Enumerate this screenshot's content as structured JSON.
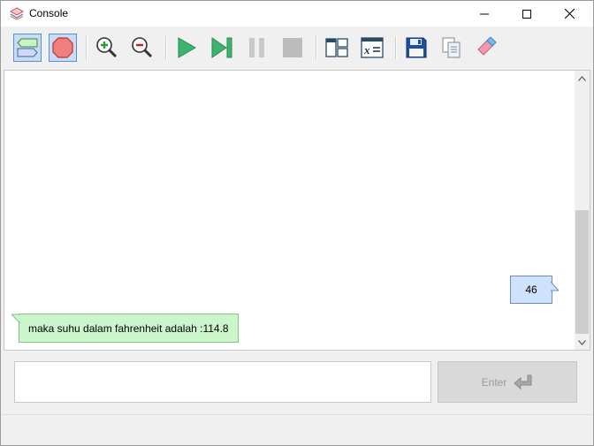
{
  "window": {
    "title": "Console"
  },
  "titlebar": {
    "minimize_icon": "minimize-icon",
    "maximize_icon": "maximize-icon",
    "close_icon": "close-icon"
  },
  "toolbar": {
    "buttons": [
      {
        "name": "console-mode-icon",
        "toggled": true
      },
      {
        "name": "stop-sign-icon",
        "toggled": true
      },
      {
        "name": "zoom-in-icon",
        "toggled": false
      },
      {
        "name": "zoom-out-icon",
        "toggled": false
      },
      {
        "name": "run-icon",
        "toggled": false
      },
      {
        "name": "step-icon",
        "toggled": false
      },
      {
        "name": "pause-icon",
        "toggled": false
      },
      {
        "name": "stop-icon",
        "toggled": false
      },
      {
        "name": "layout-icon",
        "toggled": false
      },
      {
        "name": "variables-icon",
        "toggled": false
      },
      {
        "name": "save-icon",
        "toggled": false
      },
      {
        "name": "copy-icon",
        "toggled": false
      },
      {
        "name": "eraser-icon",
        "toggled": false
      }
    ]
  },
  "console": {
    "input_message": "46",
    "output_message": "maka suhu dalam fahrenheit adalah :114.8"
  },
  "input": {
    "value": "",
    "placeholder": ""
  },
  "enter_button": {
    "label": "Enter",
    "icon": "enter-return-icon"
  },
  "colors": {
    "input_bubble_bg": "#cfe2fc",
    "output_bubble_bg": "#ccf5cc",
    "toggle_bg": "#c9dcf5",
    "run_green": "#3cb371",
    "save_blue": "#1f4e9c"
  }
}
